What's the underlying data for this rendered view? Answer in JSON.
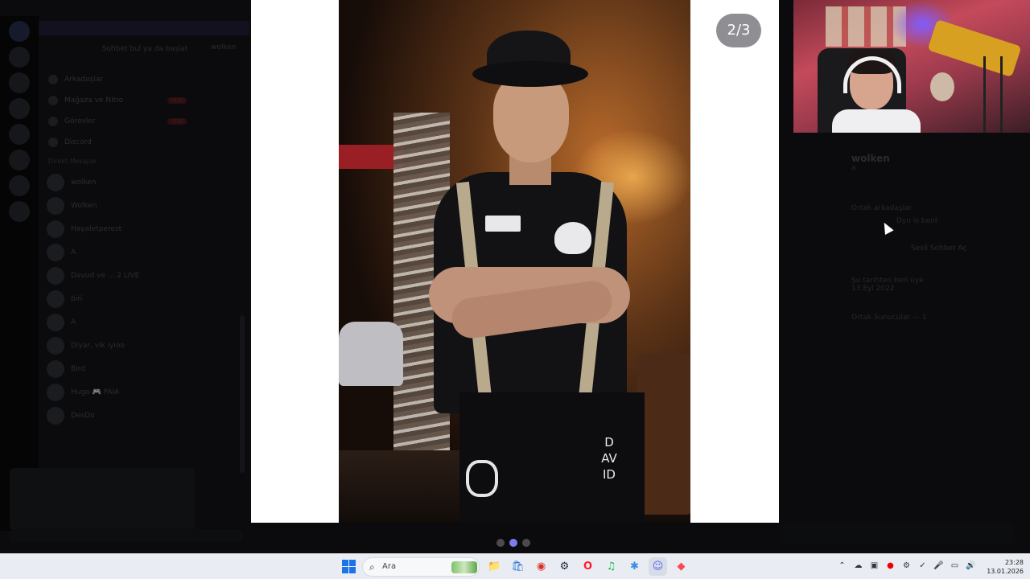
{
  "background": {
    "dm_title": "Sohbet bul ya da başlat",
    "channel_header": "wolken",
    "nav_items": [
      {
        "label": "Arkadaşlar"
      },
      {
        "label": "Mağaza ve Nitro",
        "badge": "YENİ"
      },
      {
        "label": "Görevler",
        "badge": "YENİ"
      },
      {
        "label": "Discord"
      }
    ],
    "dm_section_header": "Direkt Mesajlar",
    "dm_list": [
      "wolken",
      "Wolken",
      "Hayaletperest",
      "A",
      "Davud ve ... 2 LIVE",
      "biri",
      "A",
      "Diyar, vik iyioo",
      "Bird",
      "Hugo 🎮 PAIA",
      "DesDo"
    ],
    "profile": {
      "name": "wolken",
      "handle": "a",
      "section": "Ortak arkadaşlar",
      "activity": "Dyn is bent",
      "button": "Sesli Sohbet Aç",
      "since_label": "Şu tarihten beri üye",
      "since_date": "13 Eyl 2022",
      "mutual": "Ortak Sunucular — 1"
    }
  },
  "viewer": {
    "counter": "2/3",
    "apron_text": "DAVID",
    "dots": [
      {
        "active": false
      },
      {
        "active": true
      },
      {
        "active": false
      }
    ]
  },
  "taskbar": {
    "search_placeholder": "Ara",
    "apps": [
      {
        "icon": "file-explorer-icon",
        "glyph": "📁"
      },
      {
        "icon": "store-icon",
        "glyph": "🛍"
      },
      {
        "icon": "chrome-icon",
        "glyph": "◉"
      },
      {
        "icon": "steam-icon",
        "glyph": "⚙"
      },
      {
        "icon": "opera-icon",
        "glyph": "O"
      },
      {
        "icon": "spotify-icon",
        "glyph": "♫"
      },
      {
        "icon": "settings-icon",
        "glyph": "✱"
      },
      {
        "icon": "discord-icon",
        "glyph": "☺"
      },
      {
        "icon": "valorant-icon",
        "glyph": "◆"
      }
    ],
    "time": "23:28",
    "date": "13.01.2026"
  }
}
